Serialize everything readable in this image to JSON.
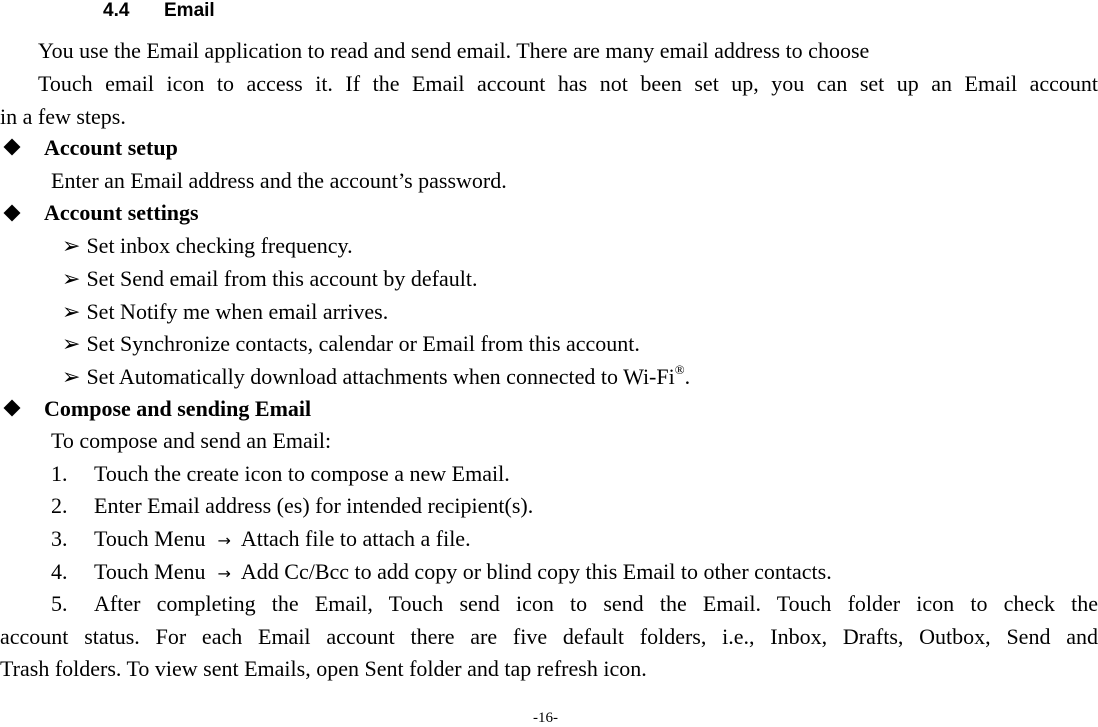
{
  "section": {
    "number": "4.4",
    "title": "Email"
  },
  "intro": [
    "You use the Email application to read and send email. There are many email address to choose",
    "Touch email icon to access it. If the Email account has not been set up, you can set up an Email account",
    "in a few steps."
  ],
  "account_setup": {
    "heading": "Account setup",
    "text": "Enter an Email address and the account’s password."
  },
  "account_settings": {
    "heading": "Account settings",
    "items": [
      "Set inbox checking frequency.",
      "Set Send email from this account by default.",
      "Set Notify me when email arrives.",
      "Set Synchronize contacts, calendar or Email from this account.",
      "Set Automatically download attachments when connected to Wi-Fi"
    ],
    "last_item_suffix_sup": "®",
    "last_item_suffix": "."
  },
  "compose": {
    "heading": "Compose and sending Email",
    "intro": "To compose and send an Email:",
    "steps": [
      {
        "num": "1.",
        "text": "Touch the create icon to compose a new Email."
      },
      {
        "num": "2.",
        "text": "Enter Email address (es) for intended recipient(s)."
      },
      {
        "num": "3.",
        "pre": "Touch Menu",
        "arrow": "→",
        "text": "Attach file to attach a file."
      },
      {
        "num": "4.",
        "pre": "Touch Menu",
        "arrow": "→",
        "text": "Add Cc/Bcc to add copy or blind copy this Email to other contacts."
      },
      {
        "num": "5.",
        "text": "After completing the Email, Touch send icon to send the Email. Touch folder icon to check the"
      }
    ],
    "step5_cont": [
      "account status. For each Email account there are five default folders, i.e., Inbox, Drafts, Outbox, Send and",
      "Trash folders. To view sent Emails, open Sent folder and tap refresh icon."
    ]
  },
  "bullet_arrow": "➢",
  "footer": {
    "page": "-16-"
  }
}
